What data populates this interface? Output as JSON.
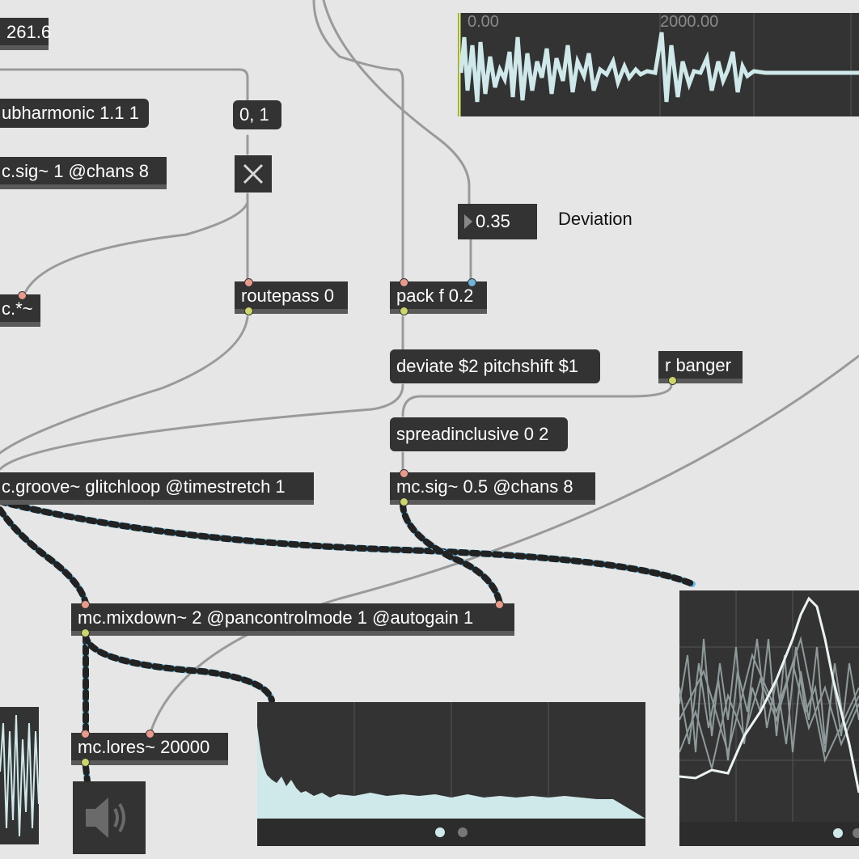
{
  "objects": {
    "number_261": "261.6",
    "subharmonic": "ubharmonic 1.1 1",
    "msg_01": "0, 1",
    "mcsig_partial": "c.sig~ 1 @chans 8",
    "mcmul_partial": "c.*~",
    "routepass": "routepass 0",
    "packf": "pack f 0.2",
    "deviate": "deviate $2 pitchshift $1",
    "rbanger": "r banger",
    "spreadinclusive": "spreadinclusive 0 2",
    "mcgroove": "c.groove~ glitchloop @timestretch 1",
    "mcsig": "mc.sig~ 0.5 @chans 8",
    "mixdown": "mc.mixdown~ 2 @pancontrolmode 1 @autogain 1",
    "lores": "mc.lores~ 20000"
  },
  "deviation": {
    "value": "0.35",
    "label": "Deviation"
  },
  "waveform": {
    "tick_left": "0.00",
    "tick_right": "2000.00"
  },
  "icons": {
    "toggle": "close-x-icon",
    "speaker": "speaker-icon"
  },
  "colors": {
    "background": "#e6e6e6",
    "object": "#333333",
    "signal_cord": "#63c1e8",
    "waveform_fill": "#cfe8ea",
    "inlet": "#e99a8a",
    "outlet": "#ccd66a"
  }
}
